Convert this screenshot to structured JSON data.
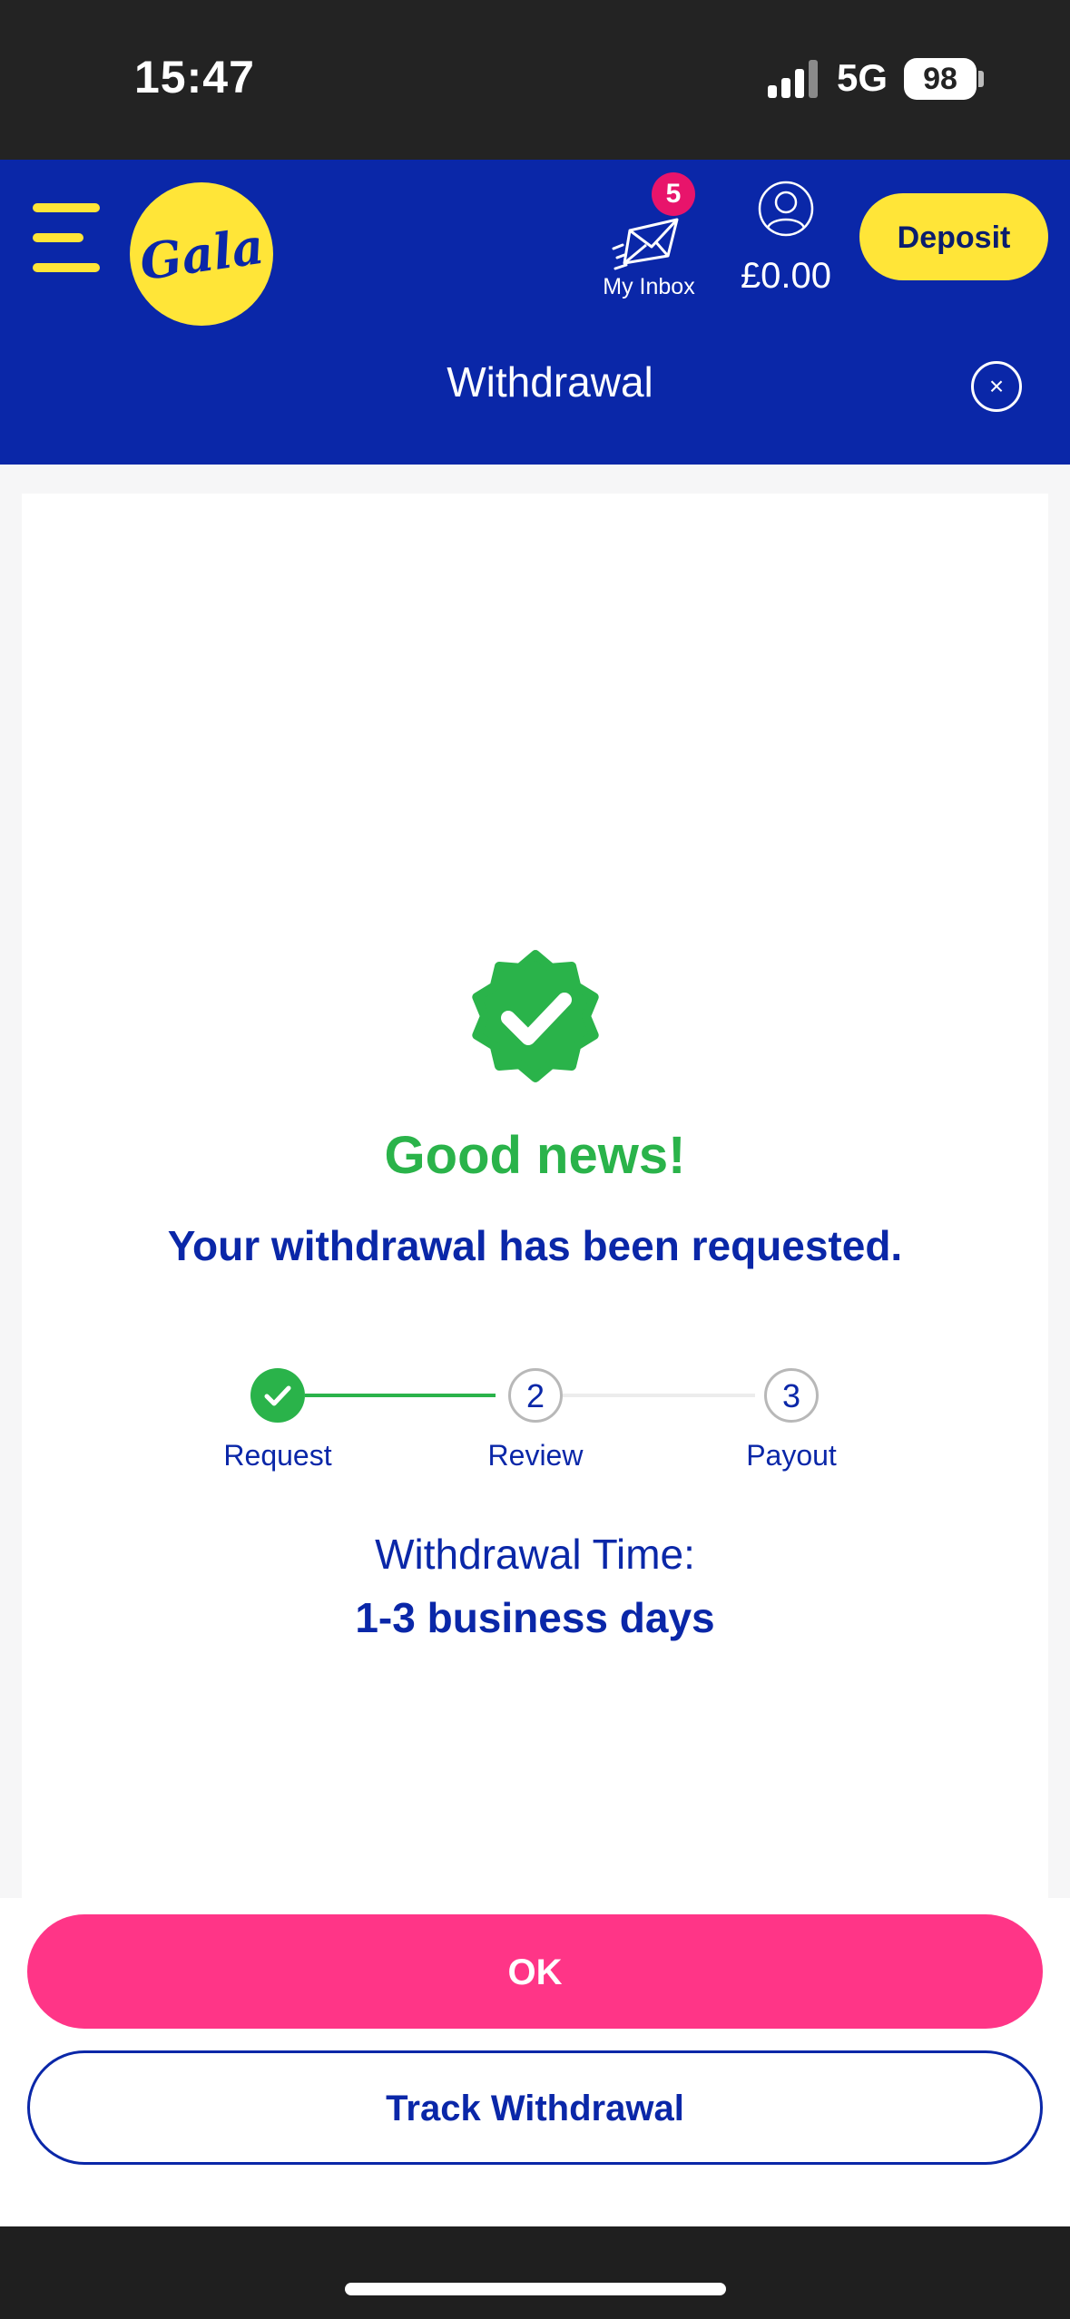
{
  "status_bar": {
    "time": "15:47",
    "network": "5G",
    "battery": "98"
  },
  "header": {
    "logo_text": "Gala",
    "inbox_label": "My Inbox",
    "inbox_badge": "5",
    "balance": "£0.00",
    "deposit_label": "Deposit",
    "page_title": "Withdrawal",
    "close_glyph": "×"
  },
  "content": {
    "headline": "Good news!",
    "message": "Your withdrawal has been requested.",
    "steps": [
      {
        "number": "1",
        "label": "Request",
        "state": "complete"
      },
      {
        "number": "2",
        "label": "Review",
        "state": "pending"
      },
      {
        "number": "3",
        "label": "Payout",
        "state": "pending"
      }
    ],
    "withdrawal_time_label": "Withdrawal Time:",
    "withdrawal_time_value": "1-3 business days"
  },
  "actions": {
    "ok_label": "OK",
    "track_label": "Track Withdrawal"
  },
  "icons": {
    "menu": "hamburger-menu-icon",
    "inbox": "envelope-icon",
    "account": "user-icon",
    "success": "check-badge-icon"
  },
  "colors": {
    "brand_blue": "#0a27a8",
    "brand_yellow": "#ffe538",
    "success_green": "#2ab34a",
    "primary_pink": "#ff3587",
    "badge_red": "#e8146b"
  }
}
